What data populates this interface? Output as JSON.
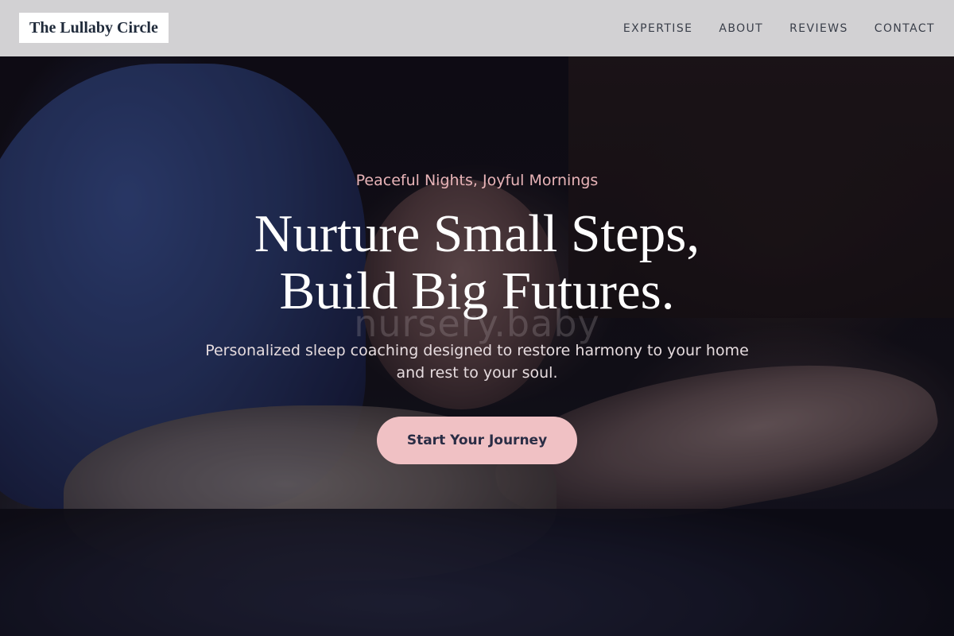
{
  "navbar": {
    "brand": "The Lullaby Circle",
    "links": [
      {
        "label": "EXPERTISE"
      },
      {
        "label": "ABOUT"
      },
      {
        "label": "REVIEWS"
      },
      {
        "label": "CONTACT"
      }
    ]
  },
  "hero": {
    "tagline": "Peaceful Nights, Joyful Mornings",
    "headline_line1": "Nurture Small Steps,",
    "headline_line2": "Build Big Futures.",
    "watermark": "nursery.baby",
    "subtext": "Personalized sleep coaching designed to restore harmony to your home and rest to your soul.",
    "cta_label": "Start Your Journey"
  },
  "colors": {
    "accent": "#f0c1c4",
    "tagline": "#e8b4b8",
    "navbar_bg": "#e1e1e2",
    "brand_text": "#1f2a3a"
  }
}
